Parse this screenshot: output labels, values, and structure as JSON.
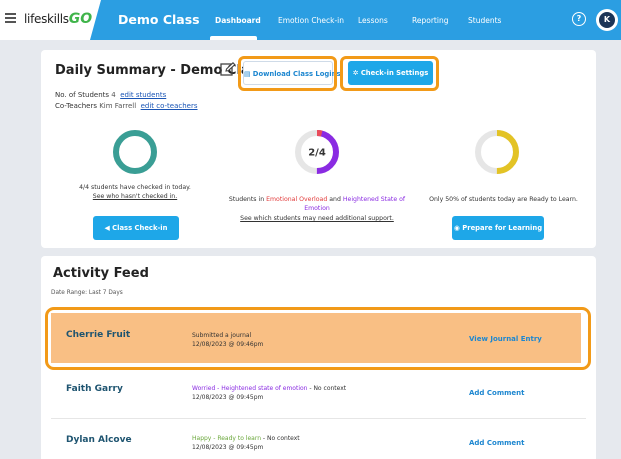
{
  "app": {
    "logo_text": "lifeskills",
    "logo_go": "GO",
    "class_name": "Demo Class"
  },
  "nav": {
    "items": [
      "Dashboard",
      "Emotion Check-in",
      "Lessons",
      "Reporting",
      "Students"
    ],
    "active": "Dashboard",
    "help_glyph": "?",
    "avatar_initial": "K"
  },
  "summary": {
    "title": "Daily Summary - Demo Class",
    "download_label": "Download Class Logins",
    "settings_label": "Check-in Settings",
    "students_label": "No. of Students",
    "students_count": "4",
    "edit_students": "edit students",
    "coteachers_label": "Co-Teachers",
    "coteachers_value": "Kim Farrell",
    "edit_coteachers": "edit co-teachers",
    "stats": [
      {
        "progress": 1.0,
        "color": "#3a9e95",
        "text": "4/4 students have checked in today.",
        "link": "See who hasn't checked in.",
        "button": "Class Check-in"
      },
      {
        "progress": 0.5,
        "color": "#8a2be2",
        "accent": "#e94b5a",
        "center": "2/4",
        "text_prefix": "Students in",
        "emotional": "Emotional Overload",
        "text_and": "and",
        "heightened": "Heightened State",
        "of_emotion": "of Emotion",
        "link": "See which students may need additional support."
      },
      {
        "progress": 0.5,
        "color": "#e3c325",
        "text": "Only 50% of students today are Ready to Learn.",
        "button": "Prepare for Learning"
      }
    ]
  },
  "feed": {
    "title": "Activity Feed",
    "date_range": "Date Range: Last 7 Days",
    "rows": [
      {
        "name": "Cherrie Fruit",
        "line1": "Submitted a journal",
        "date": "12/08/2023 @ 09:46pm",
        "action": "View Journal Entry"
      },
      {
        "name": "Faith Garry",
        "emotion": "Worried - Heightened state of emotion",
        "context": " - No context",
        "date": "12/08/2023 @ 09:45pm",
        "action": "Add Comment"
      },
      {
        "name": "Dylan Alcove",
        "emotion": "Happy - Ready to learn",
        "context": " - No context",
        "date": "12/08/2023 @ 09:45pm",
        "action": "Add Comment"
      }
    ]
  },
  "colors": {
    "nav": "#2b9ee2",
    "highlight": "#f29a18",
    "highlight_row": "#f9bf84",
    "button": "#1ea7e8"
  }
}
